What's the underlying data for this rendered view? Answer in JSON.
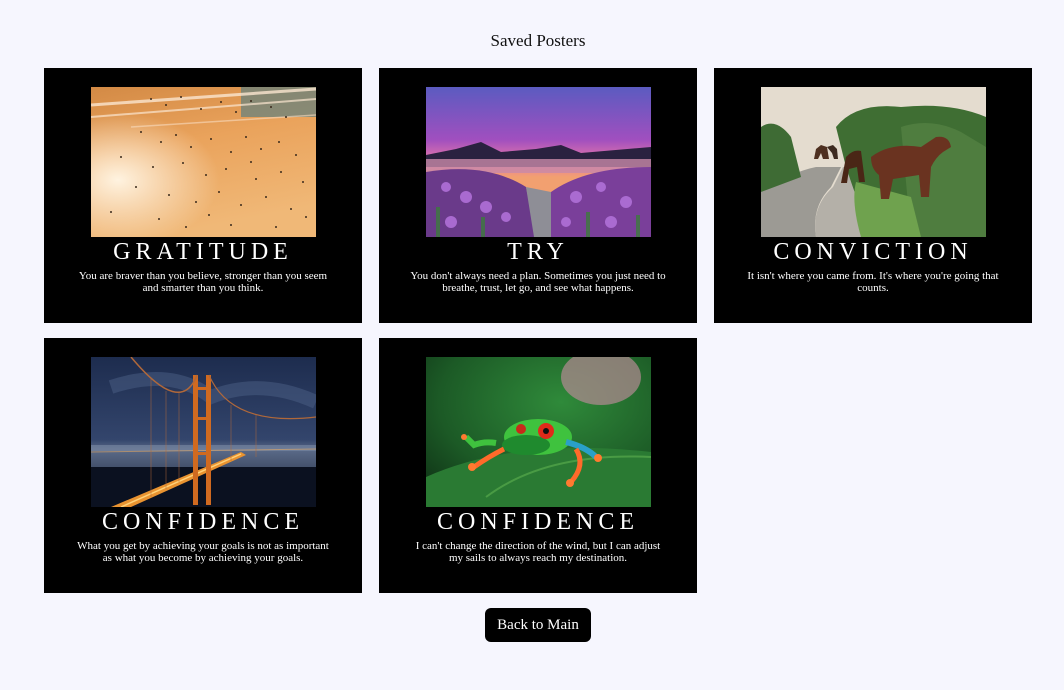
{
  "page": {
    "title": "Saved Posters"
  },
  "posters": [
    {
      "image": "birds-at-sunset-photo",
      "title": "GRATITUDE",
      "quote": "You are braver than you believe, stronger than you seem and smarter than you think."
    },
    {
      "image": "lavender-lake-mountain-photo",
      "title": "TRY",
      "quote": "You don't always need a plan. Sometimes you just need to breathe, trust, let go, and see what happens."
    },
    {
      "image": "horses-on-road-photo",
      "title": "CONVICTION",
      "quote": "It isn't where you came from. It's where you're going that counts."
    },
    {
      "image": "golden-gate-bridge-night-photo",
      "title": "CONFIDENCE",
      "quote": "What you get by achieving your goals is not as important as what you become by achieving your goals."
    },
    {
      "image": "red-eyed-tree-frog-photo",
      "title": "CONFIDENCE",
      "quote": "I can't change the direction of the wind, but I can adjust my sails to always reach my destination."
    }
  ],
  "actions": {
    "back_label": "Back to Main"
  },
  "colors": {
    "background": "#f6f6fe",
    "poster_background": "#000000",
    "text_on_poster": "#ffffff",
    "button_background": "#000000"
  }
}
